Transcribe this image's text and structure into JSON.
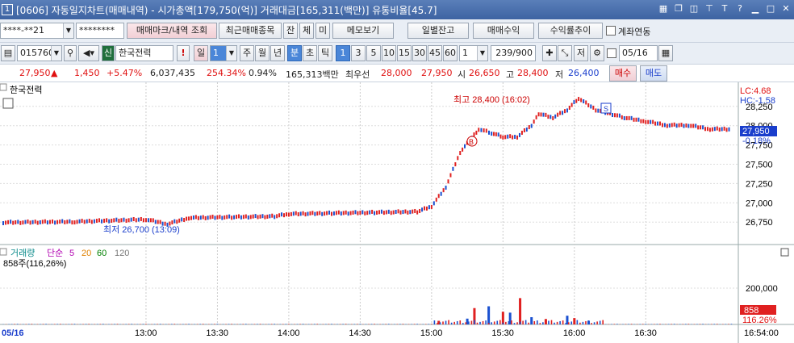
{
  "title": {
    "num": "1",
    "text": "[0606] 자동일지차트(매매내역) - 시가총액[179,750(억)] 거래대금[165,311(백만)] 유통비율[45.7]"
  },
  "toolbar1": {
    "account": "****-**21",
    "password": "********",
    "trade_mark_btn": "매매마크/내역 조회",
    "recent_btn": "최근매매종목",
    "jan": "잔",
    "che": "체",
    "mi": "미",
    "memo_btn": "메모보기",
    "daily_btn": "일별잔고",
    "profit_btn": "매매수익",
    "rate_btn": "수익률추이",
    "link_label": "계좌연동"
  },
  "toolbar2": {
    "code": "015760",
    "credit": "신",
    "name": "한국전력",
    "warn": "!",
    "period": "일",
    "period_num": "1",
    "week": "주",
    "month": "월",
    "year": "년",
    "minute": "분",
    "second": "초",
    "tick": "틱",
    "intervals": [
      "1",
      "3",
      "5",
      "10",
      "15",
      "30",
      "45",
      "60"
    ],
    "count_sel": "1",
    "count": "239/900",
    "save": "저",
    "date": "05/16"
  },
  "quote": {
    "price": "27,950",
    "arrow": "▲",
    "change": "1,450",
    "rate": "+5.47%",
    "volume": "6,037,435",
    "vol_rate": "254.34%",
    "turnover": "0.94%",
    "amount": "165,313백만",
    "best": "최우선",
    "ask": "28,000",
    "bid": "27,950",
    "open_l": "시",
    "open": "26,650",
    "high_l": "고",
    "high": "28,400",
    "low_l": "저",
    "low": "26,400",
    "buy": "매수",
    "sell": "매도"
  },
  "chart": {
    "stock_label": "한국전력",
    "lc": "LC:4.68",
    "hc": "HC:-1.58",
    "cur_price": "27,950",
    "cur_rate": "-0.18%",
    "high_note": "최고 28,400 (16:02)",
    "low_note": "최저 26,700 (13:09)",
    "b_mark": "B",
    "s_mark": "S",
    "vol_legend": {
      "t1": "거래량",
      "t2": "단순",
      "ma": [
        "5",
        "20",
        "60",
        "120"
      ]
    },
    "vol_info": "858주(116,26%)",
    "vol_cur": "858",
    "vol_rate": "116.26%",
    "date_label": "05/16",
    "end_time": "16:54:00"
  },
  "chart_data": {
    "type": "candlestick",
    "x_ticks": [
      "13:00",
      "13:30",
      "14:00",
      "14:30",
      "15:00",
      "15:30",
      "16:00",
      "16:30"
    ],
    "price_ticks": [
      28250,
      28000,
      27750,
      27500,
      27250,
      27000,
      26750
    ],
    "volume_ticks": [
      200000
    ],
    "price_path": [
      [
        12.0,
        26740
      ],
      [
        12.5,
        26750
      ],
      [
        13.0,
        26780
      ],
      [
        13.15,
        26720
      ],
      [
        13.3,
        26800
      ],
      [
        13.6,
        26810
      ],
      [
        13.9,
        26820
      ],
      [
        14.0,
        26850
      ],
      [
        14.3,
        26860
      ],
      [
        14.6,
        26870
      ],
      [
        14.9,
        26880
      ],
      [
        15.0,
        26950
      ],
      [
        15.1,
        27200
      ],
      [
        15.2,
        27650
      ],
      [
        15.33,
        27950
      ],
      [
        15.42,
        27900
      ],
      [
        15.5,
        27850
      ],
      [
        15.6,
        27850
      ],
      [
        15.7,
        28000
      ],
      [
        15.75,
        28150
      ],
      [
        15.85,
        28100
      ],
      [
        15.95,
        28200
      ],
      [
        16.03,
        28350
      ],
      [
        16.15,
        28200
      ],
      [
        16.35,
        28100
      ],
      [
        16.5,
        28050
      ],
      [
        16.65,
        28000
      ],
      [
        16.8,
        28000
      ],
      [
        16.95,
        27950
      ],
      [
        17.1,
        27950
      ]
    ],
    "volume_bars": [
      [
        15.05,
        20000
      ],
      [
        15.25,
        32000
      ],
      [
        15.3,
        90000
      ],
      [
        15.4,
        100000
      ],
      [
        15.5,
        70000
      ],
      [
        15.55,
        65000
      ],
      [
        15.62,
        145000
      ],
      [
        15.7,
        40000
      ],
      [
        15.8,
        30000
      ],
      [
        15.95,
        48000
      ],
      [
        16.0,
        35000
      ],
      [
        16.1,
        20000
      ]
    ]
  }
}
